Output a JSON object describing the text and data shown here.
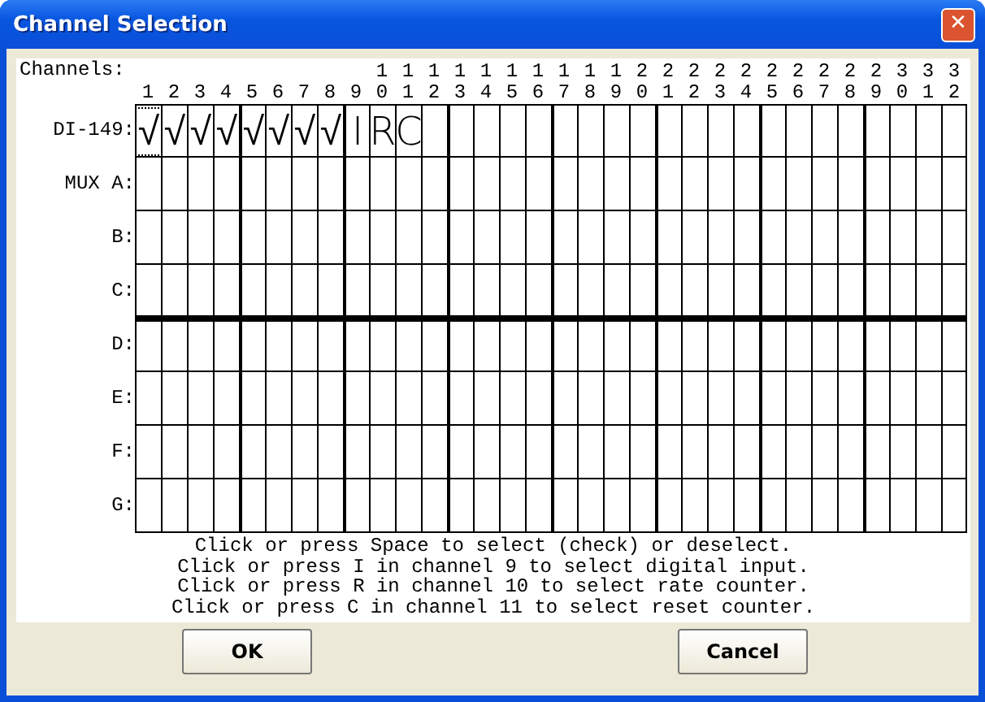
{
  "window": {
    "title": "Channel Selection",
    "close": "✕"
  },
  "grid": {
    "caption": "Channels:",
    "columns": [
      "1",
      "2",
      "3",
      "4",
      "5",
      "6",
      "7",
      "8",
      "9",
      "10",
      "11",
      "12",
      "13",
      "14",
      "15",
      "16",
      "17",
      "18",
      "19",
      "20",
      "21",
      "22",
      "23",
      "24",
      "25",
      "26",
      "27",
      "28",
      "29",
      "30",
      "31",
      "32"
    ],
    "rows": [
      {
        "label": "DI-149:",
        "cells": [
          {
            "text": "√",
            "focused": true
          },
          {
            "text": "√",
            "focused": false
          },
          {
            "text": "√",
            "focused": false
          },
          {
            "text": "√",
            "focused": false
          },
          {
            "text": "√",
            "focused": false
          },
          {
            "text": "√",
            "focused": false
          },
          {
            "text": "√",
            "focused": false
          },
          {
            "text": "√",
            "focused": false
          },
          {
            "text": "I",
            "focused": false
          },
          {
            "text": "R",
            "focused": false
          },
          {
            "text": "C",
            "focused": false
          }
        ]
      },
      {
        "label": "MUX A:"
      },
      {
        "label": "B:"
      },
      {
        "label": "C:"
      },
      {
        "label": "D:"
      },
      {
        "label": "E:"
      },
      {
        "label": "F:"
      },
      {
        "label": "G:"
      }
    ]
  },
  "help": [
    "Click or press Space to select (check) or deselect.",
    "Click or press I in channel 9 to select digital input.",
    "Click or press R in channel 10 to select rate counter.",
    "Click or press C in channel 11 to select reset counter."
  ],
  "buttons": [
    "OK",
    "Cancel"
  ]
}
